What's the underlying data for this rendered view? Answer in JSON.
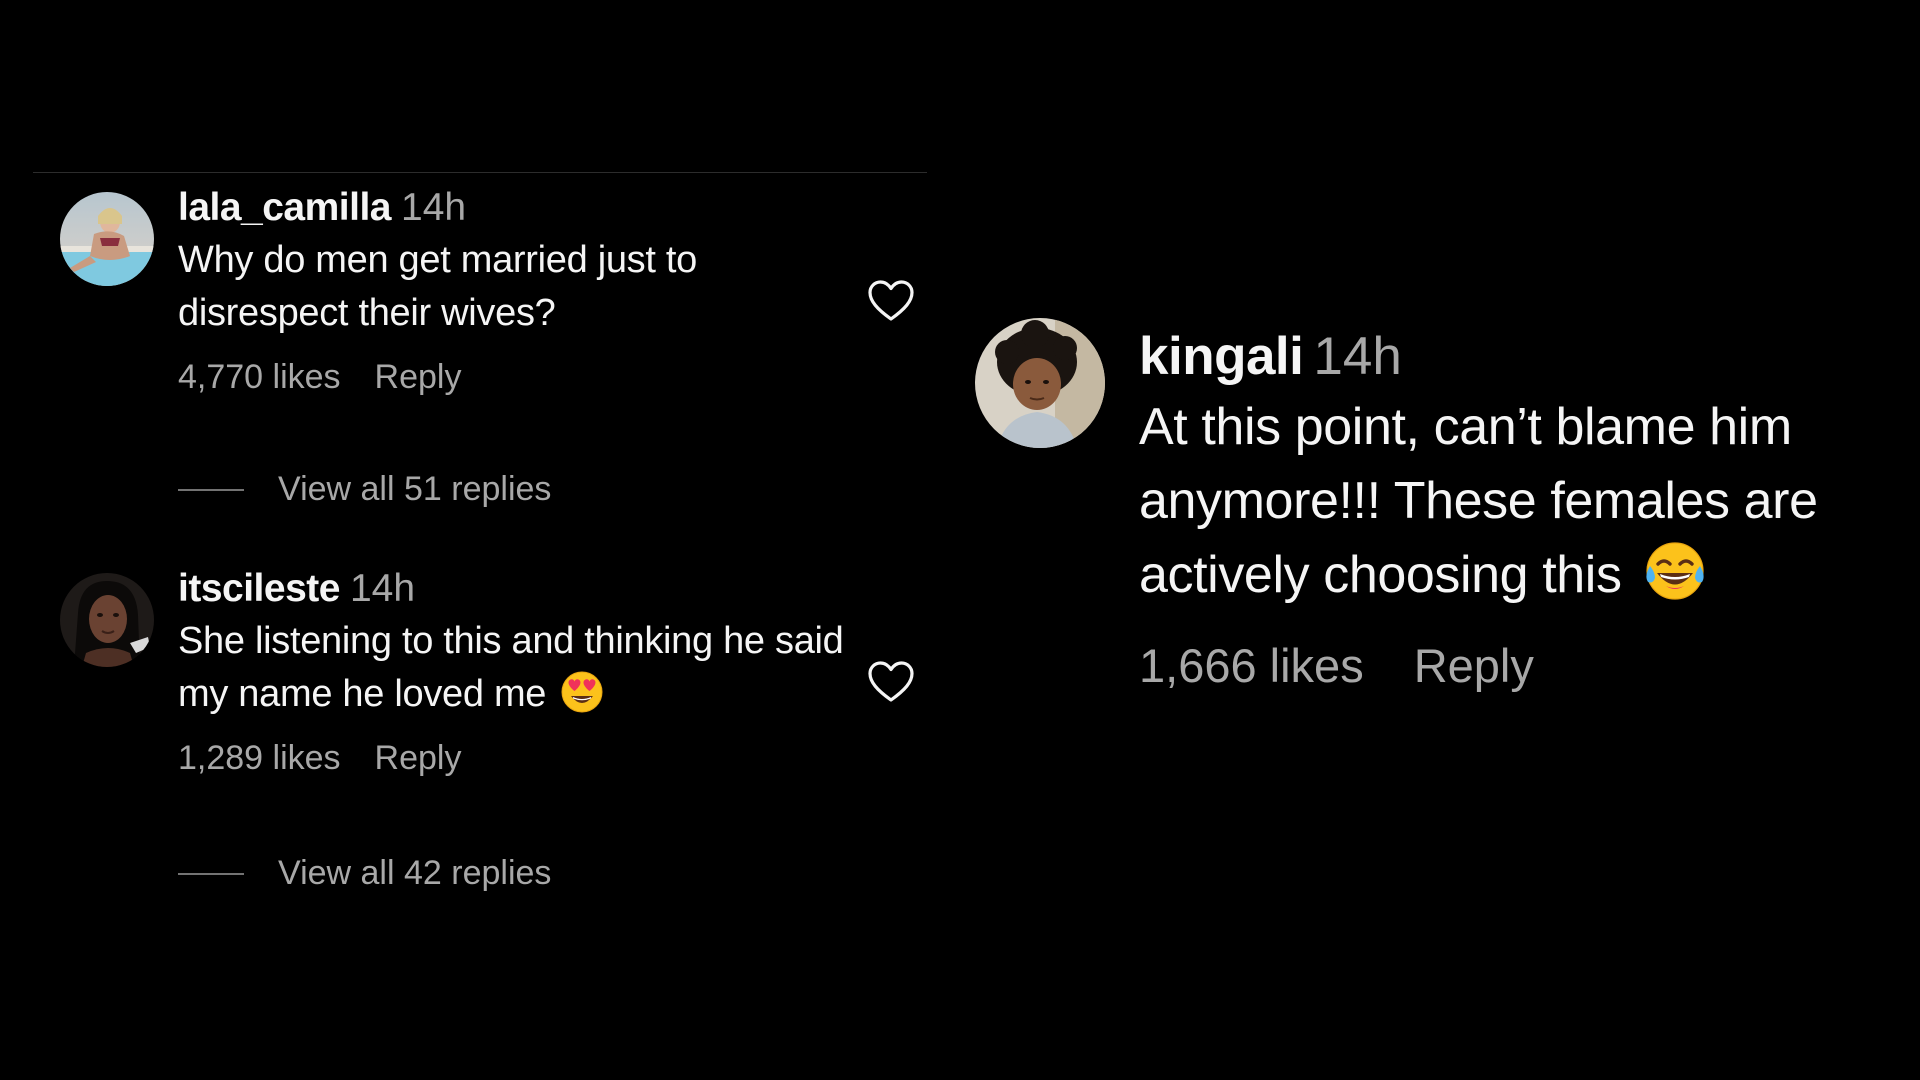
{
  "left_panel": {
    "comments": [
      {
        "username": "lala_camilla",
        "time": "14h",
        "text": "Why do men get married just to disrespect their wives?",
        "likes": "4,770 likes",
        "reply_label": "Reply",
        "view_replies": "View all 51 replies",
        "avatar_icon": "user-avatar-pool-photo"
      },
      {
        "username": "itscileste",
        "time": "14h",
        "text": "She listening to this and thinking he said my name he loved me",
        "emoji": "smiling-face-with-heart-eyes-icon",
        "likes": "1,289 likes",
        "reply_label": "Reply",
        "view_replies": "View all 42 replies",
        "avatar_icon": "user-avatar-portrait"
      }
    ]
  },
  "right_panel": {
    "comment": {
      "username": "kingali",
      "time": "14h",
      "text": "At this point, can’t blame him anymore!!! These females are actively choosing this",
      "emoji": "face-with-tears-of-joy-icon",
      "likes": "1,666 likes",
      "reply_label": "Reply",
      "avatar_icon": "user-avatar-child-portrait"
    }
  },
  "colors": {
    "background": "#000000",
    "primary_text": "#f5f5f5",
    "secondary_text": "#a8a8a8",
    "divider": "#2c2c2c"
  }
}
